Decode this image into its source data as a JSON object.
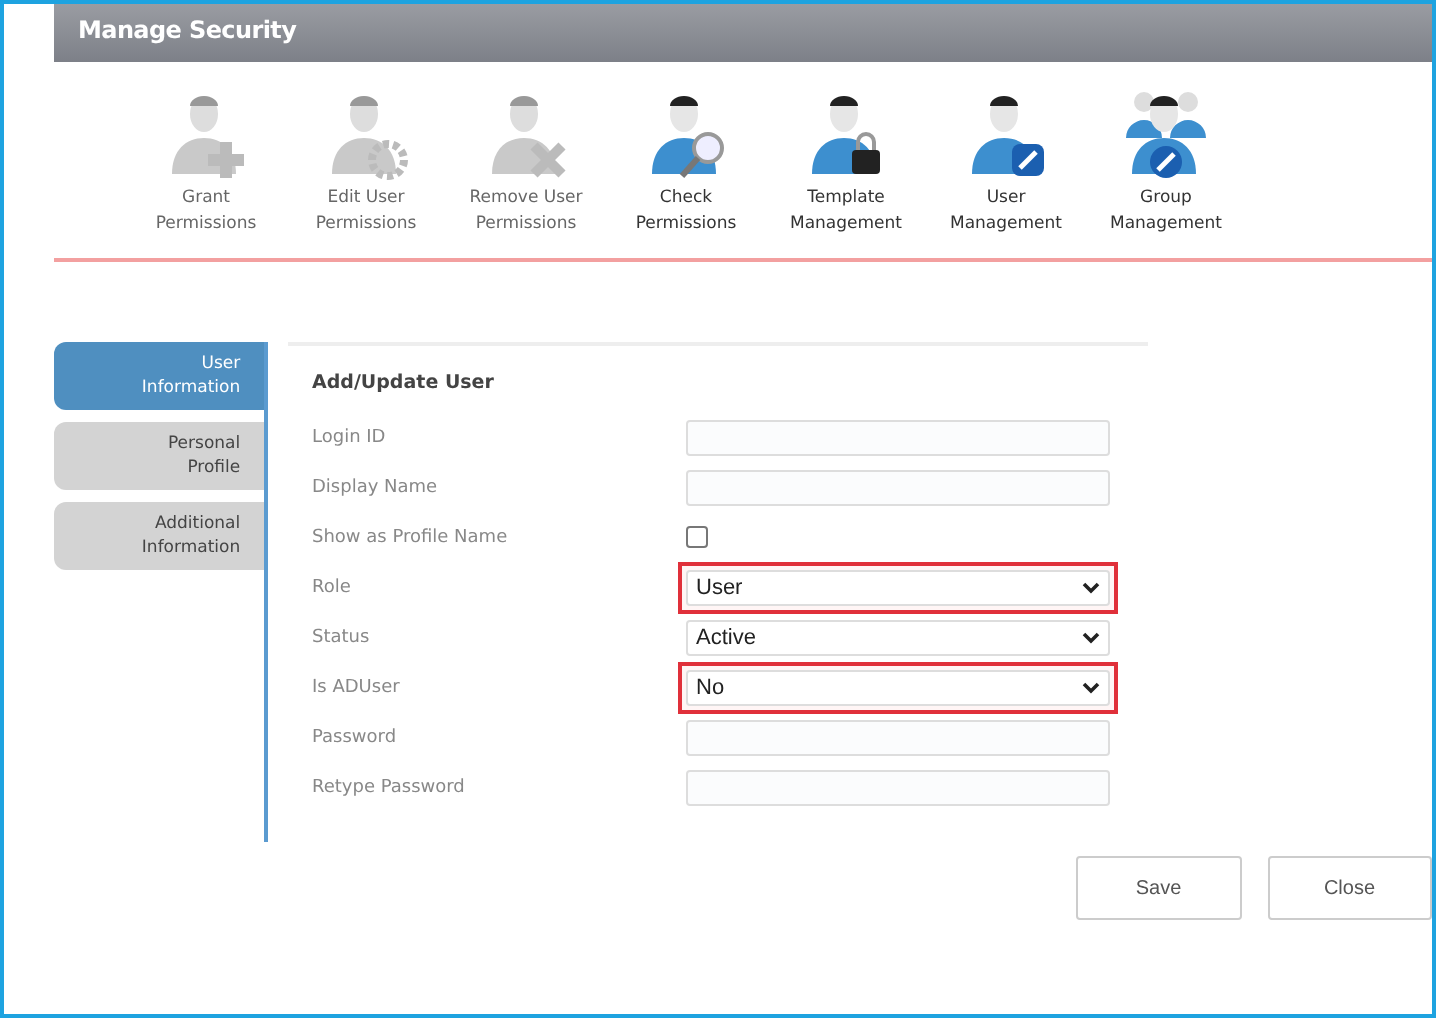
{
  "header": {
    "title": "Manage Security"
  },
  "toolbar": [
    {
      "label": "Grant Permissions",
      "enabled": false
    },
    {
      "label": "Edit User Permissions",
      "enabled": false
    },
    {
      "label": "Remove User Permissions",
      "enabled": false
    },
    {
      "label": "Check Permissions",
      "enabled": true
    },
    {
      "label": "Template Management",
      "enabled": true
    },
    {
      "label": "User Management",
      "enabled": true
    },
    {
      "label": "Group Management",
      "enabled": true
    }
  ],
  "side_tabs": [
    {
      "label": "User Information",
      "selected": true
    },
    {
      "label": "Personal Profile",
      "selected": false
    },
    {
      "label": "Additional Information",
      "selected": false
    }
  ],
  "form": {
    "title": "Add/Update User",
    "fields": [
      {
        "kind": "text",
        "label": "Login ID"
      },
      {
        "kind": "text",
        "label": "Display Name"
      },
      {
        "kind": "checkbox",
        "label": "Show as Profile Name",
        "checked": false
      },
      {
        "kind": "select",
        "label": "Role",
        "value": "User",
        "highlighted": true
      },
      {
        "kind": "select",
        "label": "Status",
        "value": "Active",
        "highlighted": false
      },
      {
        "kind": "select",
        "label": "Is ADUser",
        "value": "No",
        "highlighted": true
      },
      {
        "kind": "text",
        "label": "Password"
      },
      {
        "kind": "text",
        "label": "Retype Password"
      }
    ]
  },
  "buttons": [
    "Save",
    "Close"
  ]
}
